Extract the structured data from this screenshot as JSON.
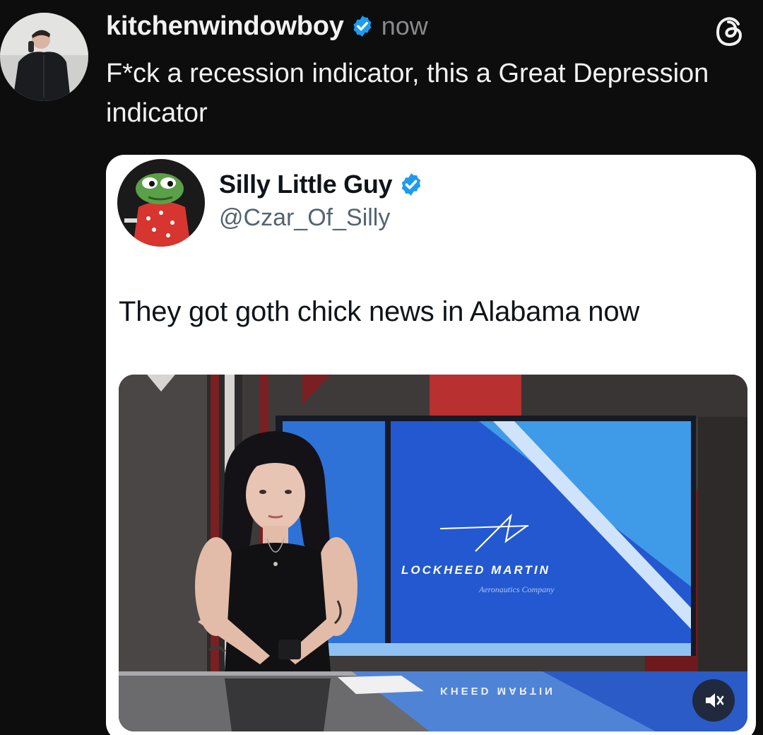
{
  "post": {
    "username": "kitchenwindowboy",
    "verified": true,
    "timestamp": "now",
    "text": "F*ck a recession indicator, this a Great Depression indicator",
    "app_icon": "threads-icon"
  },
  "quoted_tweet": {
    "display_name": "Silly Little Guy",
    "handle": "@Czar_Of_Silly",
    "verified": true,
    "text": "They got goth chick news in Alabama now",
    "media": {
      "screen_brand": "LOCKHEED MARTIN",
      "screen_subtitle": "Aeronautics Company",
      "desk_reflection": "KHEED MARTIN",
      "mute_icon": "speaker-muted-icon"
    }
  },
  "colors": {
    "background": "#0d0d0e",
    "verified_badge": "#1d9bf0",
    "card_bg": "#ffffff"
  }
}
